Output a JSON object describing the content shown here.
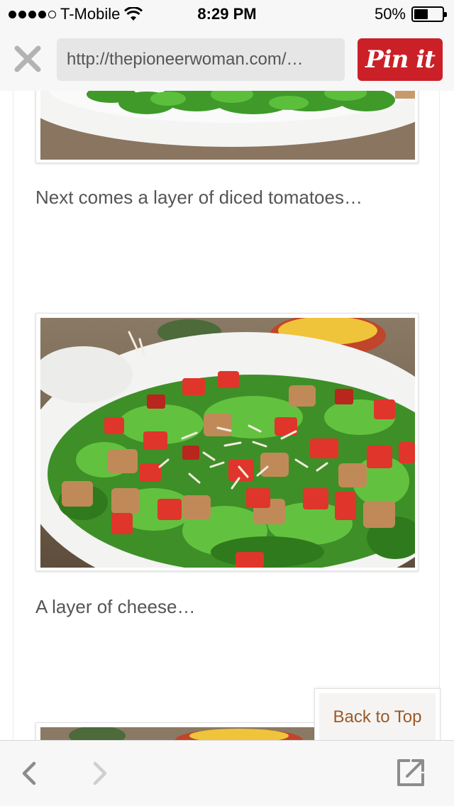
{
  "status_bar": {
    "carrier": "T-Mobile",
    "time": "8:29 PM",
    "battery_percent": "50%",
    "battery_level": 0.5,
    "signal_bars_filled": 4,
    "signal_bars_total": 5
  },
  "address_bar": {
    "url": "http://thepioneerwoman.com/…",
    "pin_label": "Pin it",
    "pin_color": "#cb2027"
  },
  "content": {
    "captions": [
      "Next comes a layer of diced tomatoes…",
      "A layer of cheese…"
    ],
    "back_to_top": "Back to Top"
  },
  "icons": {
    "close": "close-icon",
    "back": "chevron-left-icon",
    "forward": "chevron-right-icon",
    "share": "open-external-icon"
  },
  "colors": {
    "accent_brown": "#9a5a2b",
    "toolbar_gray": "#f7f7f7"
  }
}
